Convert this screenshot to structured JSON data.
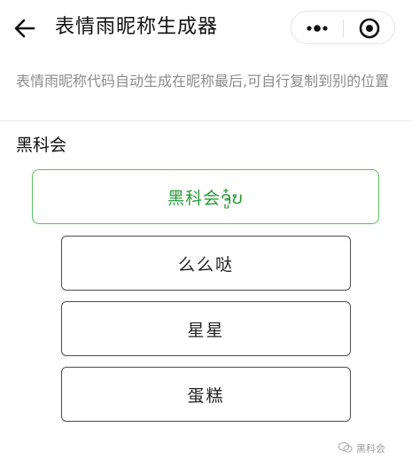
{
  "header": {
    "title": "表情雨昵称生成器"
  },
  "hint": "表情雨昵称代码自动生成在昵称最后,可自行复制到别的位置",
  "nickname": "黑科会",
  "result": "黑科会ຈູ໋ບ",
  "options": [
    {
      "label": "么么哒"
    },
    {
      "label": "星星"
    },
    {
      "label": "蛋糕"
    }
  ],
  "watermark": "黑科会",
  "colors": {
    "accent": "#2a9d36",
    "accent_border": "#5bbf63",
    "hint_text": "#8c8c8c",
    "button_border": "#4d4d4d"
  }
}
